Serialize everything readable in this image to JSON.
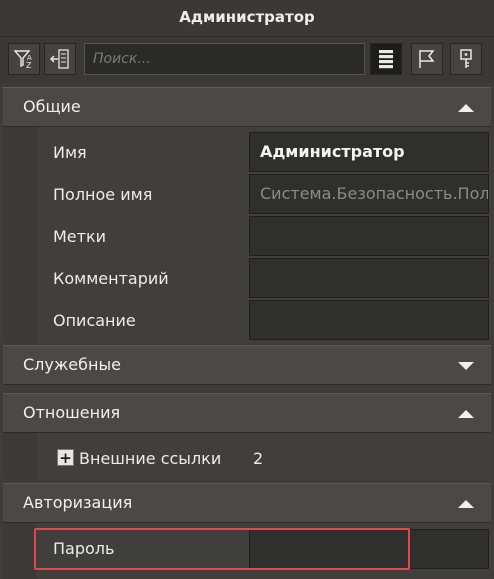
{
  "window": {
    "title": "Администратор"
  },
  "toolbar": {
    "filter_icon": "filter-sort-icon",
    "nav_icon": "navigate-back-icon",
    "search_placeholder": "Поиск...",
    "list_icon": "list-view-icon",
    "flag_icon": "flag-icon",
    "key_icon": "key-icon"
  },
  "sections": {
    "general": {
      "label": "Общие",
      "expanded": true
    },
    "service": {
      "label": "Служебные",
      "expanded": false
    },
    "relations": {
      "label": "Отношения",
      "expanded": true
    },
    "auth": {
      "label": "Авторизация",
      "expanded": true
    }
  },
  "general_fields": {
    "name_label": "Имя",
    "name_value": "Администратор",
    "fullname_label": "Полное имя",
    "fullname_value": "Система.Безопасность.Пол",
    "tags_label": "Метки",
    "tags_value": "",
    "comment_label": "Комментарий",
    "comment_value": "",
    "description_label": "Описание",
    "description_value": ""
  },
  "relations_fields": {
    "external_links_label": "Внешние ссылки",
    "external_links_count": "2",
    "expand_symbol": "+"
  },
  "auth_fields": {
    "password_label": "Пароль",
    "password_value": ""
  },
  "colors": {
    "highlight": "#e0484d",
    "panel_bg": "#3e3d3a",
    "section_bg": "#4a4946",
    "cell_bg": "#2f2f2d"
  }
}
